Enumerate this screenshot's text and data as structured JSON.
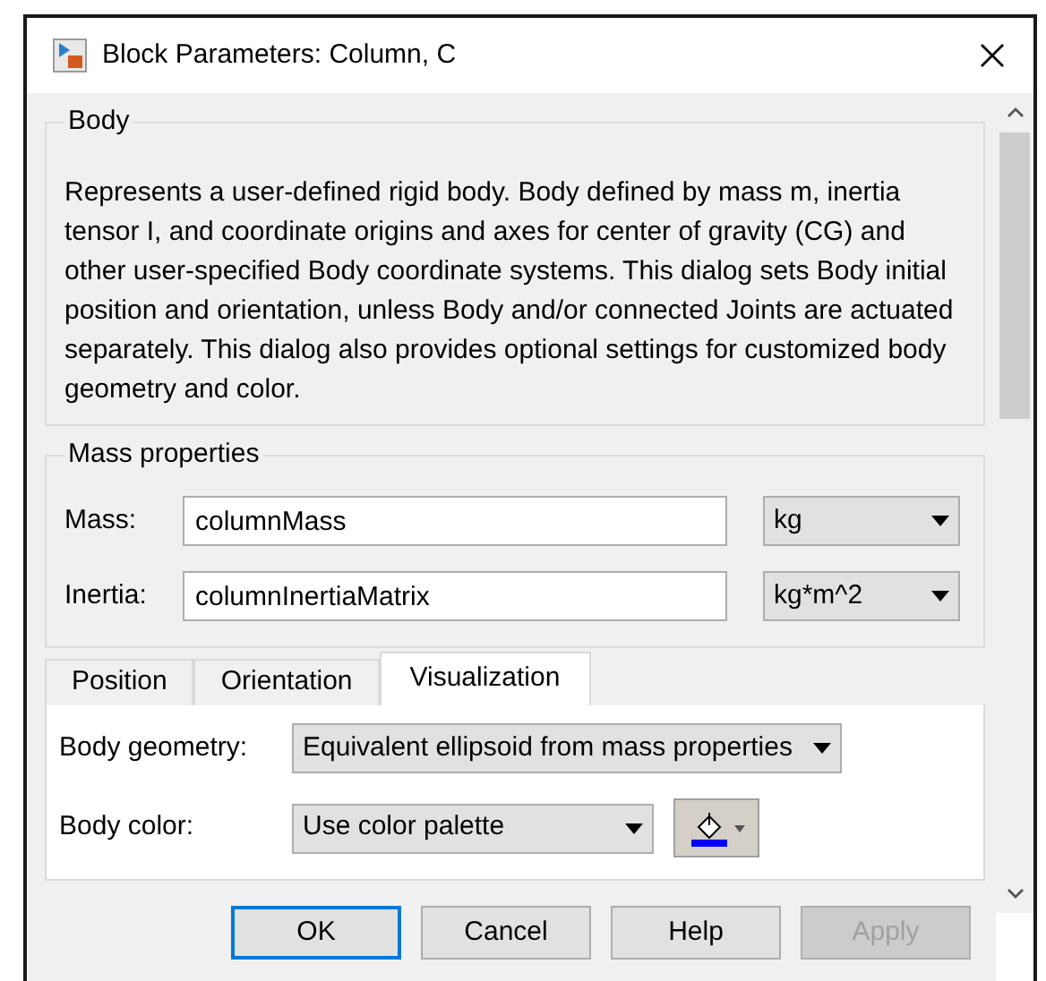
{
  "window": {
    "title": "Block Parameters: Column, C"
  },
  "body_group": {
    "title": "Body",
    "description": "Represents a user-defined rigid body. Body defined by mass m, inertia tensor I, and coordinate origins and axes for center of gravity (CG) and other user-specified Body coordinate systems. This dialog sets Body initial position and orientation, unless Body and/or connected Joints are actuated separately. This dialog also provides optional settings for customized body geometry and color."
  },
  "mass_group": {
    "title": "Mass properties",
    "rows": [
      {
        "label": "Mass:",
        "value": "columnMass",
        "unit": "kg"
      },
      {
        "label": "Inertia:",
        "value": "columnInertiaMatrix",
        "unit": "kg*m^2"
      }
    ]
  },
  "tabs": [
    {
      "label": "Position",
      "selected": false
    },
    {
      "label": "Orientation",
      "selected": false
    },
    {
      "label": "Visualization",
      "selected": true
    }
  ],
  "visualization": [
    {
      "label": "Body geometry:",
      "value": "Equivalent ellipsoid from mass properties",
      "kind": "select"
    },
    {
      "label": "Body color:",
      "value": "Use color palette",
      "kind": "select-color"
    }
  ],
  "buttons": [
    {
      "label": "OK",
      "default": true,
      "disabled": false
    },
    {
      "label": "Cancel",
      "default": false,
      "disabled": false
    },
    {
      "label": "Help",
      "default": false,
      "disabled": false
    },
    {
      "label": "Apply",
      "default": false,
      "disabled": true
    }
  ]
}
